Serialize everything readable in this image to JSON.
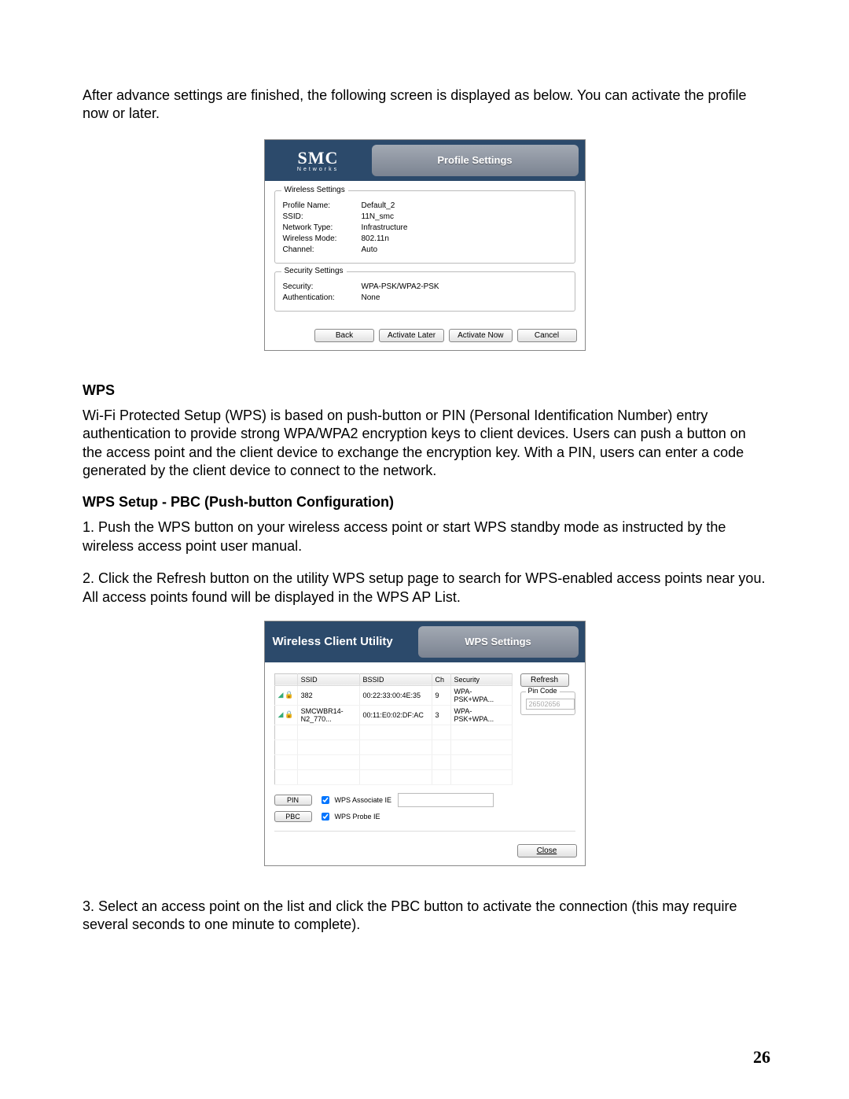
{
  "intro_text": "After advance settings are finished, the following screen is displayed as below. You can activate the profile now or later.",
  "dialog1": {
    "logo_main": "SMC",
    "logo_sub": "Networks",
    "title": "Profile Settings",
    "group_wireless": "Wireless Settings",
    "group_security": "Security Settings",
    "labels": {
      "profile_name": "Profile Name:",
      "ssid": "SSID:",
      "network_type": "Network Type:",
      "wireless_mode": "Wireless Mode:",
      "channel": "Channel:",
      "security": "Security:",
      "authentication": "Authentication:"
    },
    "values": {
      "profile_name": "Default_2",
      "ssid": "11N_smc",
      "network_type": "Infrastructure",
      "wireless_mode": "802.11n",
      "channel": "Auto",
      "security": "WPA-PSK/WPA2-PSK",
      "authentication": "None"
    },
    "buttons": {
      "back": "Back",
      "activate_later": "Activate Later",
      "activate_now": "Activate Now",
      "cancel": "Cancel"
    }
  },
  "wps_heading": "WPS",
  "wps_para": "Wi-Fi Protected Setup (WPS) is based on push-button or PIN (Personal Identification Number) entry authentication to provide strong WPA/WPA2 encryption keys to client devices. Users can push a button on the access point and the client device to exchange the encryption key. With a PIN, users can enter a code generated by the client device to connect to the network.",
  "pbc_heading": "WPS Setup - PBC (Push-button Configuration)",
  "step1": "1. Push the WPS button on your wireless access point or start WPS standby mode as instructed by the wireless access point user manual.",
  "step2": "2. Click the Refresh button on the utility WPS setup page to search for WPS-enabled access points near you. All access points found will be displayed in the WPS AP List.",
  "dialog2": {
    "product": "Wireless Client Utility",
    "title": "WPS Settings",
    "headers": {
      "ssid": "SSID",
      "bssid": "BSSID",
      "ch": "Ch",
      "security": "Security"
    },
    "rows": [
      {
        "ssid": "382",
        "bssid": "00:22:33:00:4E:35",
        "ch": "9",
        "security": "WPA-PSK+WPA..."
      },
      {
        "ssid": "SMCWBR14-N2_770...",
        "bssid": "00:11:E0:02:DF:AC",
        "ch": "3",
        "security": "WPA-PSK+WPA..."
      }
    ],
    "refresh": "Refresh",
    "pin_code_label": "Pin Code",
    "pin_value": "26502656",
    "pin_btn": "PIN",
    "pbc_btn": "PBC",
    "wps_associate": "WPS Associate IE",
    "wps_probe": "WPS Probe IE",
    "close": "Close"
  },
  "step3": "3. Select an access point on the list and click the PBC button to activate the connection (this may require several seconds to one minute to complete).",
  "page_number": "26"
}
